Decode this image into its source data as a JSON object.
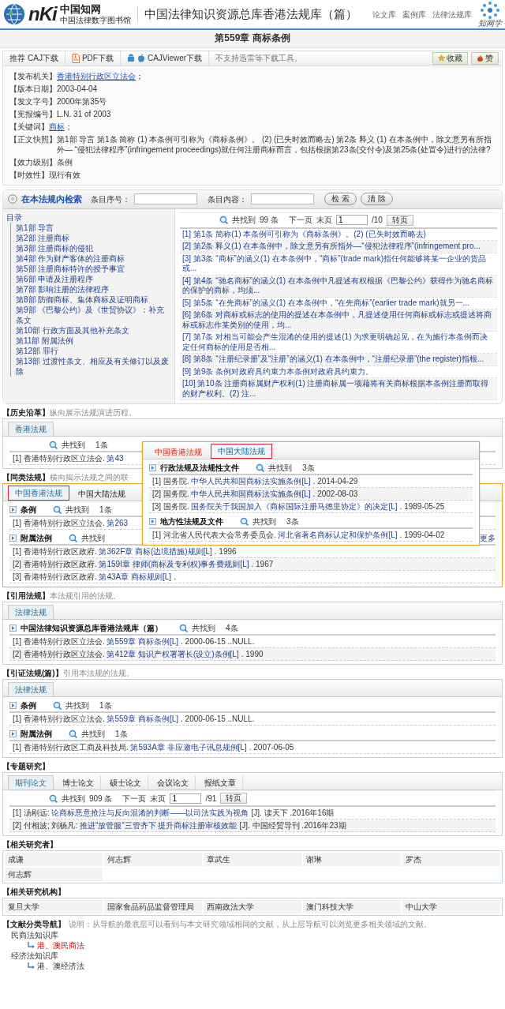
{
  "header": {
    "logo_mark": "nKi",
    "logo_name": "中国知网",
    "logo_sub": "中国法律数字图书馆",
    "title": "中国法律知识资源总库香港法规库（篇）",
    "links": [
      "论文库",
      "案例库",
      "法律法规库"
    ],
    "badge": "知网学"
  },
  "doc_title": "第559章 商标条例",
  "toolbar": {
    "downloads": [
      {
        "kind": "caj",
        "prefix": "推荐",
        "label": "CAJ下载"
      },
      {
        "kind": "pdf",
        "label": "PDF下载"
      },
      {
        "kind": "app",
        "label": "CAJViewer下载"
      }
    ],
    "note": "不支持迅雷等下载工具。",
    "actions": [
      {
        "kind": "favorite",
        "label": "收藏"
      },
      {
        "kind": "like",
        "label": "赞"
      }
    ]
  },
  "meta": [
    {
      "label": "【发布机关】",
      "value": "香港特别行政区立法会",
      "link": true,
      "suffix": "；"
    },
    {
      "label": "【版本日期】",
      "value": "2003-04-04",
      "link": false
    },
    {
      "label": "【发文字号】",
      "value": "2000年第35号",
      "link": false
    },
    {
      "label": "【宪报编号】",
      "value": "L.N. 31 of 2003",
      "link": false
    },
    {
      "label": "【关键词】",
      "value": "商标",
      "link": true,
      "suffix": "；"
    },
    {
      "label": "【正文快照】",
      "value": "第1部 导言 第1条 简称 (1) 本条例可引称为《商标条例》。 (2) (已失时效而略去) 第2条 释义 (1) 在本条例中，除文意另有所指外— “侵犯法律程序”(infringement proceedings)就任何注册商标而言，包括根据第23条(交付令)及第25条(处置令)进行的法律?",
      "link": false
    },
    {
      "label": "【效力级别】",
      "value": "条例",
      "link": false
    },
    {
      "label": "【时效性】",
      "value": "现行有效",
      "link": false
    }
  ],
  "search": {
    "title": "在本法规内检索",
    "fields": [
      {
        "label": "条目序号："
      },
      {
        "label": "条目内容："
      }
    ],
    "buttons": [
      "检 索",
      "清 除"
    ],
    "toc": {
      "title": "目录",
      "items": [
        "第1部 导言",
        "第2部 注册商标",
        "第3部 注册商标的侵犯",
        "第4部 作为财产客体的注册商标",
        "第5部 注册商标特许的授予事宜",
        "第6部 申请及注册程序",
        "第7部 影响注册的法律程序",
        "第8部 防御商标、集体商标及证明商标",
        "第9部 《巴黎公约》及《世贸协议》：补充条文",
        "第10部 行政方面及其他补充条文",
        "第11部 附属法例",
        "第12部 罪行",
        "第13部 过渡性条文、相应及有关修订以及废除"
      ]
    },
    "pager": {
      "found": "共找到",
      "count": "99 条",
      "next": "下一页",
      "last": "末页",
      "page": "1",
      "total": "/10",
      "go": "转页"
    },
    "results": [
      "[1] 第1条 简称(1) 本条例可引称为《商标条例》。(2) (已失时效而略去)",
      "[2] 第2条 释义(1) 在本条例中，除文意另有所指外—“侵犯法律程序”(infringement pro...",
      "[3] 第3条 “商标”的涵义(1) 在本条例中，“商标”(trade mark)指任何能够将某一企业的货品或...",
      "[4] 第4条 “驰名商标”的涵义(1) 在本条例中凡提述有权根据《巴黎公约》获得作为驰名商标的保护的商标，均须...",
      "[5] 第5条 “在先商标”的涵义(1) 在本条例中，“在先商标”(earlier trade mark)就另一...",
      "[6] 第6条 对商标或标志的使用的提述在本条例中，凡提述使用任何商标或标志或提述将商标或标志作某类别的使用，均...",
      "[7] 第7条 对相当可能会产生混淆的使用的提述(1) 为求更明确起见，在为施行本条例而决定任何商标的使用是否相...",
      "[8] 第8条 “注册纪录册”及“注册”的涵义(1) 在本条例中，“注册纪录册”(the register)指根...",
      "[9] 第9条 条例对政府具约束力本条例对政府具约束力。",
      "[10] 第10条 注册商标属财产权利(1) 注册商标属一项藉将有关商标根据本条例注册而取得的财产权利。(2) 注..."
    ]
  },
  "sections": [
    {
      "label": "【历史沿革】",
      "desc": "纵向展示法规演进历程。",
      "tabs": [
        {
          "label": "香港法规",
          "selected": true
        }
      ],
      "groups": [
        {
          "found": "共找到",
          "count": "1条",
          "rows": [
            {
              "prefix": "[1] 香港特别行政区立法会. ",
              "link": "第43"
            }
          ]
        }
      ]
    },
    {
      "label": "【同类法规】",
      "desc": "横向揭示法规之间的联",
      "highlight": true,
      "tabs": [
        {
          "label": "中国香港法规",
          "selected": true
        },
        {
          "label": "中国大陆法规",
          "selected": false
        }
      ],
      "groups": [
        {
          "title": "条例",
          "found": "共找到",
          "count": "1条",
          "rows": [
            {
              "prefix": "[1] 香港特别行政区立法会. ",
              "link": "第263"
            }
          ]
        },
        {
          "title": "附属法例",
          "found": "共找到",
          "more": "更多",
          "rows": [
            {
              "prefix": "[1] 香港特别行政区政府. ",
              "link": "第362F章 商标(边境措施)规则[L]",
              "suffix": ". 1996"
            },
            {
              "prefix": "[2] 香港特别行政区政府. ",
              "link": "第159I章 律师(商标及专利权)事务费规则[L]",
              "suffix": ". 1967"
            },
            {
              "prefix": "[3] 香港特别行政区政府. ",
              "link": "第43A章 商标规则[L]",
              "suffix": "."
            }
          ]
        }
      ],
      "popup": {
        "tabs": [
          {
            "label": "中国香港法规",
            "selected": false
          },
          {
            "label": "中国大陆法规",
            "selected": true
          }
        ],
        "groups": [
          {
            "title": "行政法规及法规性文件",
            "found": "共找到",
            "count": "3条",
            "rows": [
              {
                "prefix": "[1] 国务院. ",
                "link": "中华人民共和国商标法实施条例[L]",
                "suffix": ". 2014-04-29"
              },
              {
                "prefix": "[2] 国务院. ",
                "link": "中华人民共和国商标法实施条例[L]",
                "suffix": ". 2002-08-03"
              },
              {
                "prefix": "[3] 国务院. ",
                "link": "国务院关于我国加入《商标国际注册马德里协定》的决定[L]",
                "suffix": ". 1989-05-25"
              }
            ]
          },
          {
            "title": "地方性法规及文件",
            "found": "共找到",
            "count": "3条",
            "rows": [
              {
                "prefix": "[1] 河北省人民代表大会常务委员会. ",
                "link": "河北省著名商标认定和保护条例[L]",
                "suffix": ". 1999-04-02"
              }
            ]
          }
        ]
      }
    },
    {
      "label": "【引用法规】",
      "desc": "本法规引用的法规。",
      "tabs": [
        {
          "label": "法律法规",
          "selected": true
        }
      ],
      "groups": [
        {
          "title": "中国法律知识资源总库香港法规库（篇）",
          "found": "共找到",
          "count": "4条",
          "rows": [
            {
              "prefix": "[1] 香港特别行政区立法会. ",
              "link": "第559章 商标条例[L]",
              "suffix": ". 2000-06-15 ..NULL."
            },
            {
              "prefix": "[2] 香港特别行政区立法会. ",
              "link": "第412章 知识产权署署长(设立)条例[L]",
              "suffix": ". 1990"
            }
          ]
        }
      ]
    },
    {
      "label": "【引证法规(篇)】",
      "desc": "引用本法规的法规。",
      "tabs": [
        {
          "label": "法律法规",
          "selected": true
        }
      ],
      "groups": [
        {
          "title": "条例",
          "found": "共找到",
          "count": "1条",
          "rows": [
            {
              "prefix": "[1] 香港特别行政区立法会. ",
              "link": "第559章 商标条例[L]",
              "suffix": ". 2000-06-15 ..NULL."
            }
          ]
        },
        {
          "title": "附属法例",
          "found": "共找到",
          "count": "1条",
          "rows": [
            {
              "prefix": "[1] 香港特别行政区工商及科技局. ",
              "link": "第593A章 非应邀电子讯息规例[L]",
              "suffix": ". 2007-06-05"
            }
          ]
        }
      ]
    },
    {
      "label": "【专题研究】",
      "tabs": [
        {
          "label": "期刊论文",
          "selected": true
        },
        {
          "label": "博士论文",
          "selected": false
        },
        {
          "label": "硕士论文",
          "selected": false
        },
        {
          "label": "会议论文",
          "selected": false
        },
        {
          "label": "报纸文章",
          "selected": false
        }
      ],
      "groups": [
        {
          "pager": {
            "found": "共找到",
            "count": "909 条",
            "next": "下一页",
            "last": "末页",
            "page": "1",
            "total": "/91",
            "go": "转页"
          },
          "rows": [
            {
              "prefix": "[1] 汤刚远: ",
              "link": "论商标恶意抢注与反向混淆的判断——以司法实践为视角",
              "suffix": "[J]. 读天下 .2016年16期"
            },
            {
              "prefix": "[2] 付相波; 刘杨凡: ",
              "link": "推进“放管服”三管齐下 提升商标注册审核效能",
              "suffix": "[J]. 中国经贸导刊 .2016年23期"
            }
          ]
        }
      ]
    }
  ],
  "researchers": {
    "label": "【相关研究者】",
    "names": [
      "成谦",
      "何志辉",
      "章武生",
      "谢琳",
      "罗杰",
      "何志辉"
    ]
  },
  "institutions": {
    "label": "【相关研究机构】",
    "names": [
      "复旦大学",
      "国家食品药品监督管理局",
      "西南政法大学",
      "澳门科技大学",
      "中山大学"
    ]
  },
  "navigation": {
    "label": "【文献分类导航】",
    "desc": "说明：从导航的最底层可以看到与本文研究领域相同的文献，从上层导航可以浏览更多相关领域的文献。",
    "tree": [
      {
        "label": "民商法知识库",
        "children": [
          {
            "label": "港、澳民商法",
            "selected": true
          }
        ]
      },
      {
        "label": "经济法知识库",
        "children": [
          {
            "label": "港、澳经济法",
            "selected": false
          }
        ]
      }
    ]
  }
}
